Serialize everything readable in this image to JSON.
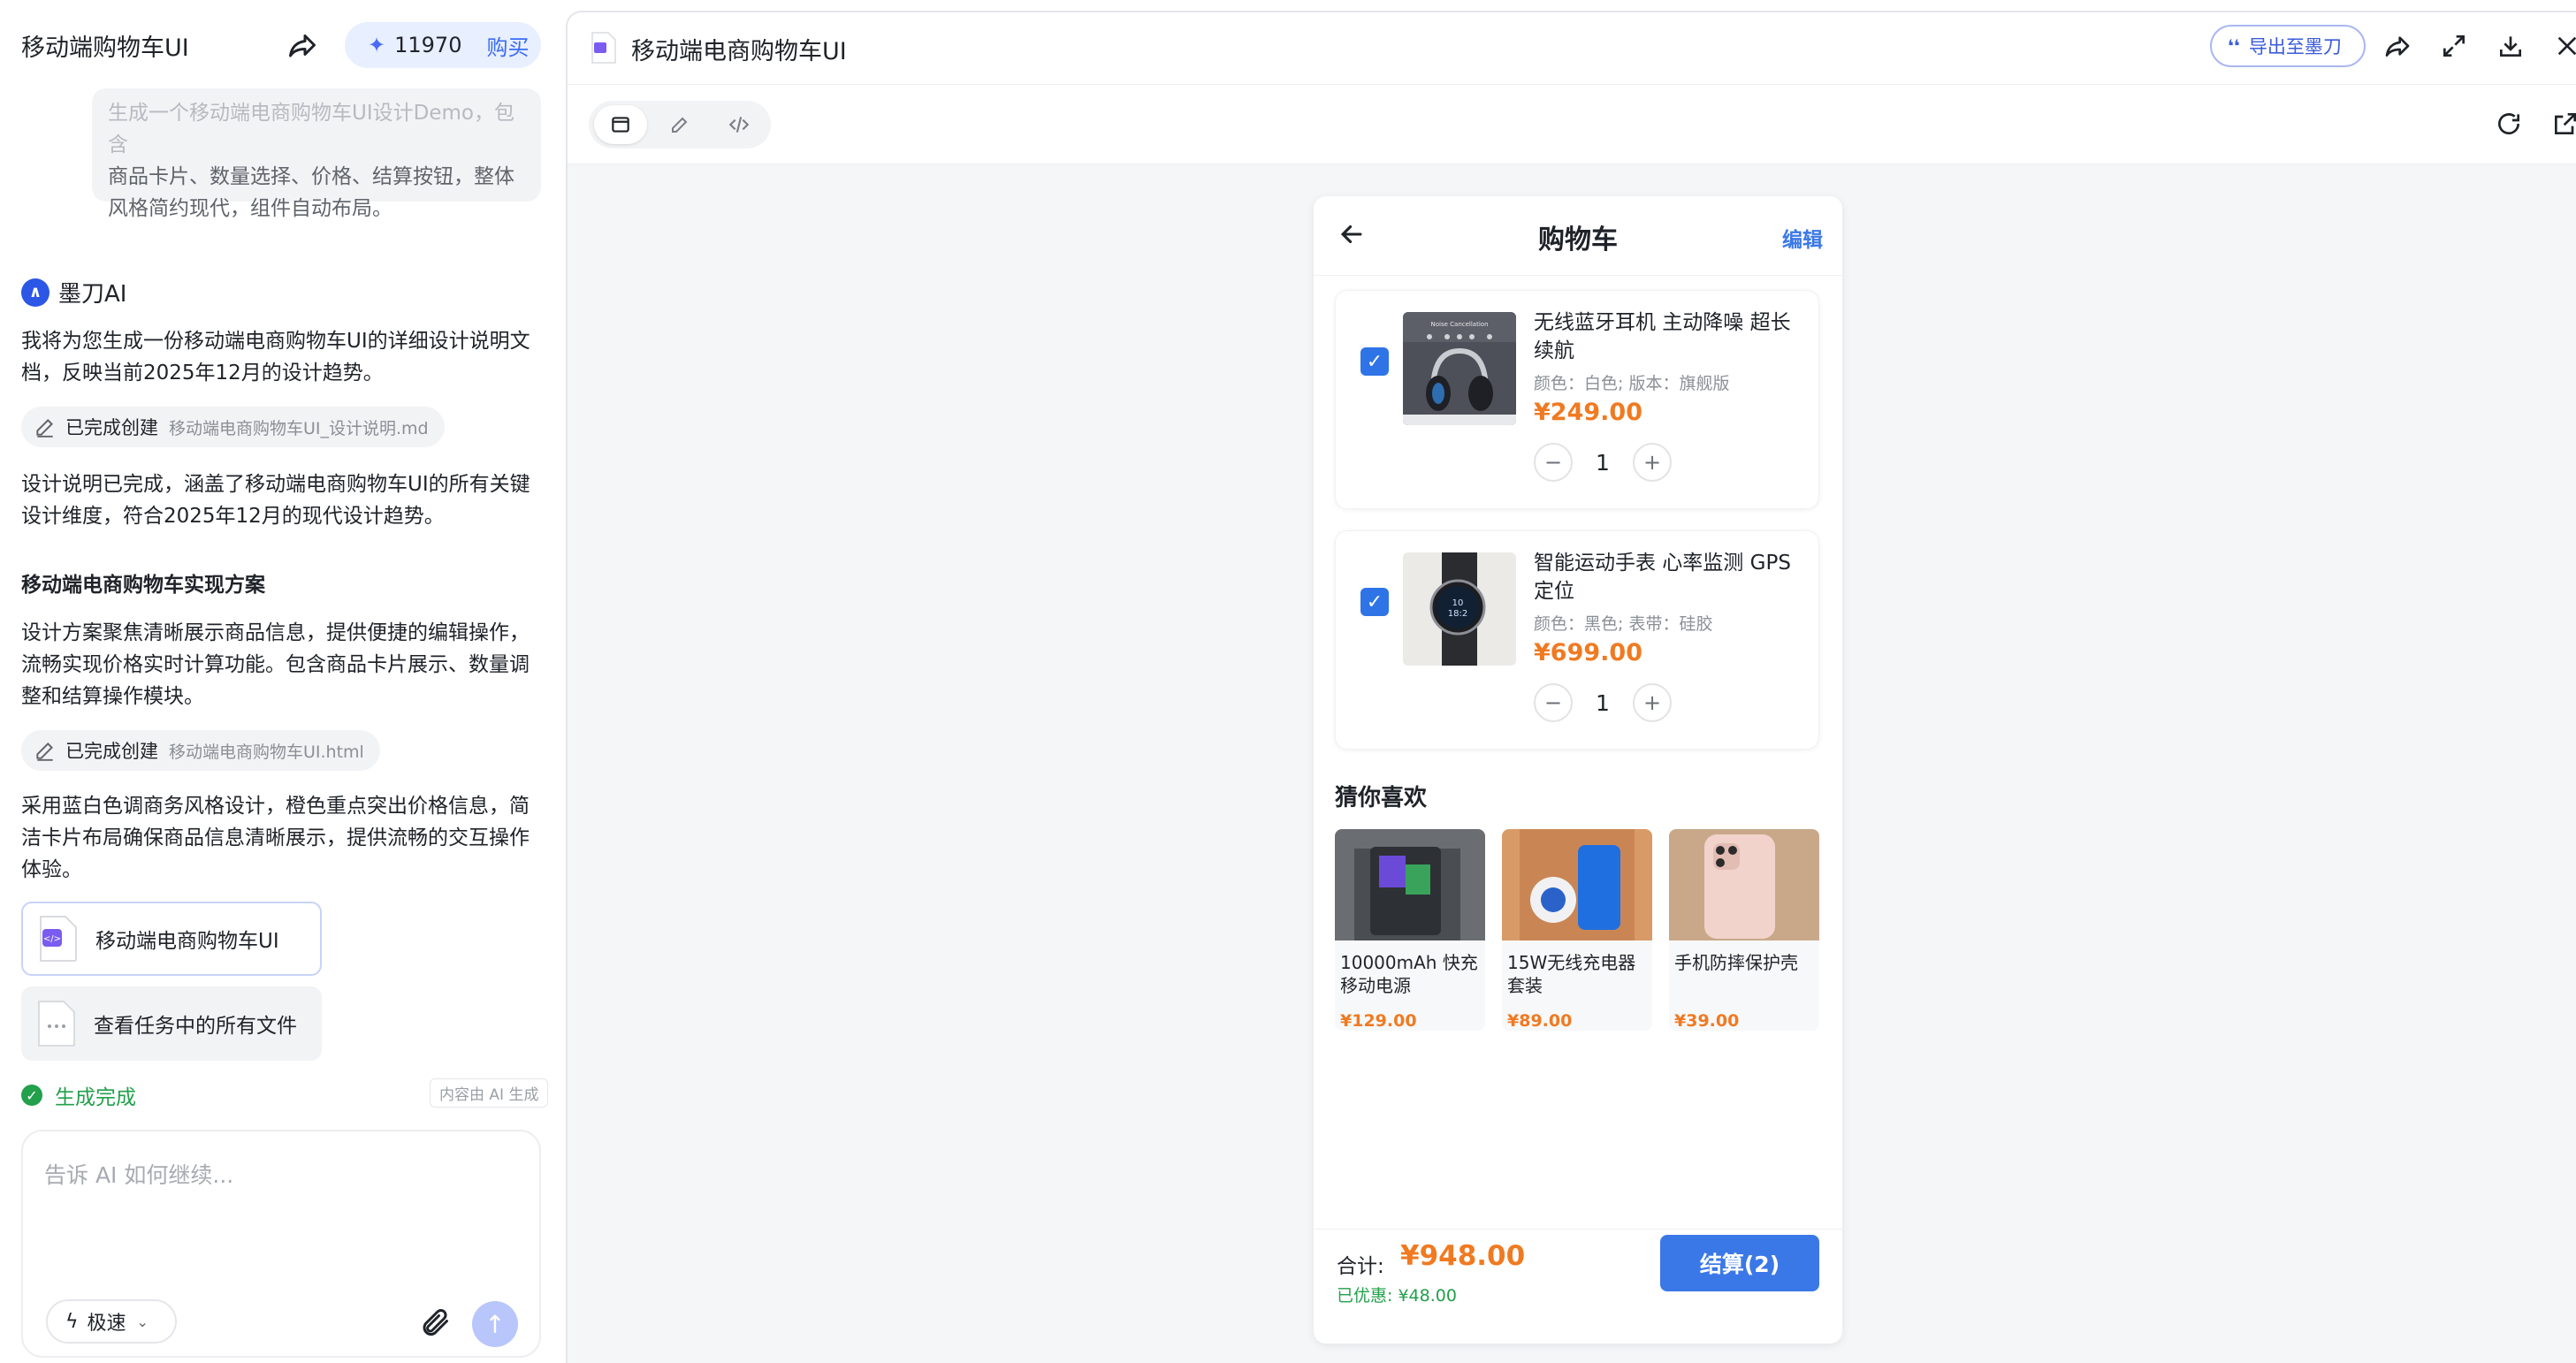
{
  "app": {
    "title": "移动端购物车UI",
    "credits": "11970",
    "buy_label": "购买"
  },
  "chat": {
    "prompt_faded": "生成一个移动端电商购物车UI设计Demo，包含",
    "prompt_rest": "商品卡片、数量选择、价格、结算按钮，整体风格简约现代，组件自动布局。",
    "assistant_name": "墨刀AI",
    "msg1": "我将为您生成一份移动端电商购物车UI的详细设计说明文档，反映当前2025年12月的设计趋势。",
    "chip1_status": "已完成创建",
    "chip1_file": "移动端电商购物车UI_设计说明.md",
    "msg2": "设计说明已完成，涵盖了移动端电商购物车UI的所有关键设计维度，符合2025年12月的现代设计趋势。",
    "heading": "移动端电商购物车实现方案",
    "msg3": "设计方案聚焦清晰展示商品信息，提供便捷的编辑操作，流畅实现价格实时计算功能。包含商品卡片展示、数量调整和结算操作模块。",
    "chip2_status": "已完成创建",
    "chip2_file": "移动端电商购物车UI.html",
    "msg4": "采用蓝白色调商务风格设计，橙色重点突出价格信息，简洁卡片布局确保商品信息清晰展示，提供流畅的交互操作体验。",
    "artifact_label": "移动端电商购物车UI",
    "all_files_label": "查看任务中的所有文件",
    "done_label": "生成完成",
    "ai_tag": "内容由 AI 生成",
    "composer_placeholder": "告诉 AI 如何继续...",
    "mode_label": "极速"
  },
  "preview": {
    "doc_title": "移动端电商购物车UI",
    "export_label": "导出至墨刀"
  },
  "phone": {
    "title": "购物车",
    "edit_label": "编辑",
    "items": [
      {
        "name": "无线蓝牙耳机 主动降噪 超长续航",
        "spec": "颜色：白色; 版本：旗舰版",
        "price": "¥249.00",
        "qty": "1",
        "checked": true
      },
      {
        "name": "智能运动手表 心率监测 GPS定位",
        "spec": "颜色：黑色; 表带：硅胶",
        "price": "¥699.00",
        "qty": "1",
        "checked": true
      }
    ],
    "rec_title": "猜你喜欢",
    "recommendations": [
      {
        "name": "10000mAh 快充移动电源",
        "price": "¥129.00"
      },
      {
        "name": "15W无线充电器套装",
        "price": "¥89.00"
      },
      {
        "name": "手机防摔保护壳",
        "price": "¥39.00"
      }
    ],
    "total_label": "合计:",
    "total_value": "¥948.00",
    "saved_label": "已优惠: ¥48.00",
    "checkout_label": "结算(2)"
  },
  "colors": {
    "accent": "#3b78e7",
    "price": "#f07a21",
    "success": "#22a04b"
  },
  "icons": [
    "share-icon",
    "sparkle-icon",
    "pen-icon",
    "html-file-icon",
    "file-icon",
    "check-circle-icon",
    "bolt-icon",
    "paperclip-icon",
    "send-icon",
    "fullscreen-icon",
    "download-icon",
    "close-icon",
    "refresh-icon",
    "open-external-icon",
    "back-arrow-icon",
    "minus-icon",
    "plus-icon",
    "checkbox-icon"
  ]
}
